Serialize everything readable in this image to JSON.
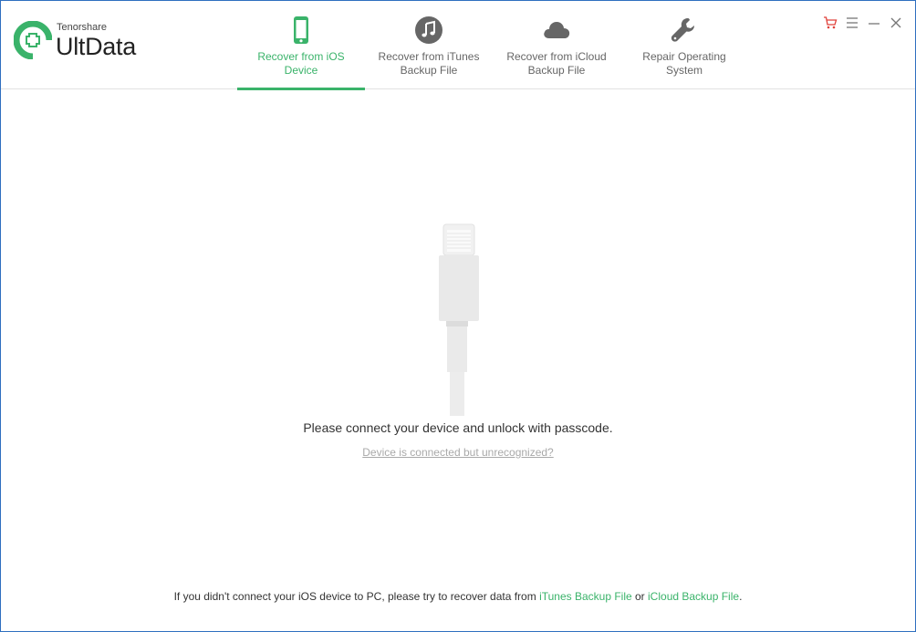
{
  "app": {
    "brand_small": "Tenorshare",
    "brand_name": "UltData",
    "accent_color": "#3ab36a"
  },
  "tabs": [
    {
      "label": "Recover from iOS\nDevice",
      "icon": "phone-icon",
      "active": true
    },
    {
      "label": "Recover from iTunes\nBackup File",
      "icon": "music-note-icon",
      "active": false
    },
    {
      "label": "Recover from iCloud\nBackup File",
      "icon": "cloud-icon",
      "active": false
    },
    {
      "label": "Repair Operating\nSystem",
      "icon": "wrench-icon",
      "active": false
    }
  ],
  "window_controls": {
    "cart": "cart-icon",
    "menu": "menu-icon",
    "minimize": "minimize-icon",
    "close": "close-icon"
  },
  "main": {
    "connect_message": "Please connect your device and unlock with passcode.",
    "unrecognized_link": "Device is connected but unrecognized?"
  },
  "footer": {
    "prefix": "If you didn't connect your iOS device to PC, please try to recover data from ",
    "itunes_link": "iTunes Backup File",
    "middle": " or ",
    "icloud_link": "iCloud Backup File",
    "suffix": "."
  }
}
